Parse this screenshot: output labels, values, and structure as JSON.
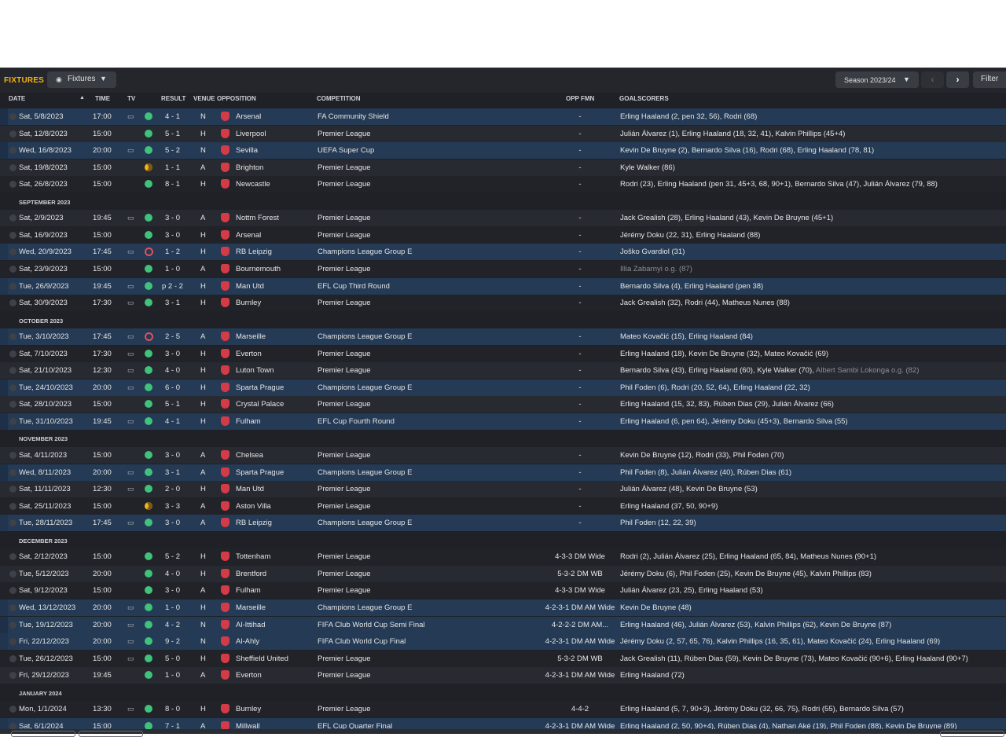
{
  "toolbar": {
    "title": "FIXTURES",
    "view_label": "Fixtures",
    "season_label": "Season 2023/24",
    "filter_label": "Filter",
    "prev_icon": "chevron-left-icon",
    "next_icon": "chevron-right-icon"
  },
  "columns": {
    "date": "DATE",
    "time": "TIME",
    "tv": "TV",
    "result": "RESULT",
    "venue": "VENUE",
    "opposition": "OPPOSITION",
    "competition": "COMPETITION",
    "opp_fmn": "OPP FMN",
    "goalscorers": "GOALSCORERS"
  },
  "colors": {
    "accent": "#f5b016",
    "win": "#3fc37a",
    "draw": "#f3b221",
    "loss": "#e0505b",
    "background": "#1f2126"
  },
  "items": [
    {
      "kind": "match",
      "date": "Sat, 5/8/2023",
      "time": "17:00",
      "tv": true,
      "outcome": "w",
      "result": "4 - 1",
      "venue": "N",
      "opp": "Arsenal",
      "comp": "FA Community Shield",
      "fmn": "-",
      "scorers": "Erling Haaland (2, pen 32, 56), Rodri (68)",
      "cont": true
    },
    {
      "kind": "match",
      "date": "Sat, 12/8/2023",
      "time": "15:00",
      "tv": false,
      "outcome": "w",
      "result": "5 - 1",
      "venue": "H",
      "opp": "Liverpool",
      "comp": "Premier League",
      "fmn": "-",
      "scorers": "Julián Álvarez (1), Erling Haaland (18, 32, 41), Kalvin Phillips (45+4)"
    },
    {
      "kind": "match",
      "date": "Wed, 16/8/2023",
      "time": "20:00",
      "tv": true,
      "outcome": "w",
      "result": "5 - 2",
      "venue": "N",
      "opp": "Sevilla",
      "comp": "UEFA Super Cup",
      "fmn": "-",
      "scorers": "Kevin De Bruyne (2), Bernardo Silva (16), Rodri (68), Erling Haaland (78, 81)",
      "cont": true
    },
    {
      "kind": "match",
      "date": "Sat, 19/8/2023",
      "time": "15:00",
      "tv": false,
      "outcome": "d",
      "result": "1 - 1",
      "venue": "A",
      "opp": "Brighton",
      "comp": "Premier League",
      "fmn": "-",
      "scorers": "Kyle Walker (86)"
    },
    {
      "kind": "match",
      "date": "Sat, 26/8/2023",
      "time": "15:00",
      "tv": false,
      "outcome": "w",
      "result": "8 - 1",
      "venue": "H",
      "opp": "Newcastle",
      "comp": "Premier League",
      "fmn": "-",
      "scorers": "Rodri (23), Erling Haaland (pen 31, 45+3, 68, 90+1), Bernardo Silva (47), Julián Álvarez (79, 88)"
    },
    {
      "kind": "section",
      "label": "SEPTEMBER 2023"
    },
    {
      "kind": "match",
      "date": "Sat, 2/9/2023",
      "time": "19:45",
      "tv": true,
      "outcome": "w",
      "result": "3 - 0",
      "venue": "A",
      "opp": "Nottm Forest",
      "comp": "Premier League",
      "fmn": "-",
      "scorers": "Jack Grealish (28), Erling Haaland (43), Kevin De Bruyne (45+1)"
    },
    {
      "kind": "match",
      "date": "Sat, 16/9/2023",
      "time": "15:00",
      "tv": false,
      "outcome": "w",
      "result": "3 - 0",
      "venue": "H",
      "opp": "Arsenal",
      "comp": "Premier League",
      "fmn": "-",
      "scorers": "Jérémy Doku (22, 31), Erling Haaland (88)"
    },
    {
      "kind": "match",
      "date": "Wed, 20/9/2023",
      "time": "17:45",
      "tv": true,
      "outcome": "l",
      "result": "1 - 2",
      "venue": "H",
      "opp": "RB Leipzig",
      "comp": "Champions League Group E",
      "fmn": "-",
      "scorers": "Joško Gvardiol (31)",
      "cont": true
    },
    {
      "kind": "match",
      "date": "Sat, 23/9/2023",
      "time": "15:00",
      "tv": false,
      "outcome": "w",
      "result": "1 - 0",
      "venue": "A",
      "opp": "Bournemouth",
      "comp": "Premier League",
      "fmn": "-",
      "scorers": "",
      "og": "Illia Zabarnyi o.g. (87)"
    },
    {
      "kind": "match",
      "date": "Tue, 26/9/2023",
      "time": "19:45",
      "tv": true,
      "outcome": "w",
      "result": "p 2 - 2",
      "venue": "H",
      "opp": "Man Utd",
      "comp": "EFL Cup Third Round",
      "fmn": "-",
      "scorers": "Bernardo Silva (4), Erling Haaland (pen 38)",
      "cont": true
    },
    {
      "kind": "match",
      "date": "Sat, 30/9/2023",
      "time": "17:30",
      "tv": true,
      "outcome": "w",
      "result": "3 - 1",
      "venue": "H",
      "opp": "Burnley",
      "comp": "Premier League",
      "fmn": "-",
      "scorers": "Jack Grealish (32), Rodri (44), Matheus Nunes (88)"
    },
    {
      "kind": "section",
      "label": "OCTOBER 2023"
    },
    {
      "kind": "match",
      "date": "Tue, 3/10/2023",
      "time": "17:45",
      "tv": true,
      "outcome": "l",
      "result": "2 - 5",
      "venue": "A",
      "opp": "Marseille",
      "comp": "Champions League Group E",
      "fmn": "-",
      "scorers": "Mateo Kovačić (15), Erling Haaland (84)",
      "cont": true
    },
    {
      "kind": "match",
      "date": "Sat, 7/10/2023",
      "time": "17:30",
      "tv": true,
      "outcome": "w",
      "result": "3 - 0",
      "venue": "H",
      "opp": "Everton",
      "comp": "Premier League",
      "fmn": "-",
      "scorers": "Erling Haaland (18), Kevin De Bruyne (32), Mateo Kovačić (69)"
    },
    {
      "kind": "match",
      "date": "Sat, 21/10/2023",
      "time": "12:30",
      "tv": true,
      "outcome": "w",
      "result": "4 - 0",
      "venue": "H",
      "opp": "Luton Town",
      "comp": "Premier League",
      "fmn": "-",
      "scorers": "Bernardo Silva (43), Erling Haaland (60), Kyle Walker (70), ",
      "og": "Albert Sambi Lokonga o.g. (82)"
    },
    {
      "kind": "match",
      "date": "Tue, 24/10/2023",
      "time": "20:00",
      "tv": true,
      "outcome": "w",
      "result": "6 - 0",
      "venue": "H",
      "opp": "Sparta Prague",
      "comp": "Champions League Group E",
      "fmn": "-",
      "scorers": "Phil Foden (6), Rodri (20, 52, 64), Erling Haaland (22, 32)",
      "cont": true
    },
    {
      "kind": "match",
      "date": "Sat, 28/10/2023",
      "time": "15:00",
      "tv": false,
      "outcome": "w",
      "result": "5 - 1",
      "venue": "H",
      "opp": "Crystal Palace",
      "comp": "Premier League",
      "fmn": "-",
      "scorers": "Erling Haaland (15, 32, 83), Rúben Dias (29), Julián Álvarez (66)"
    },
    {
      "kind": "match",
      "date": "Tue, 31/10/2023",
      "time": "19:45",
      "tv": true,
      "outcome": "w",
      "result": "4 - 1",
      "venue": "H",
      "opp": "Fulham",
      "comp": "EFL Cup Fourth Round",
      "fmn": "-",
      "scorers": "Erling Haaland (6, pen 64), Jérémy Doku (45+3), Bernardo Silva (55)",
      "cont": true
    },
    {
      "kind": "section",
      "label": "NOVEMBER 2023"
    },
    {
      "kind": "match",
      "date": "Sat, 4/11/2023",
      "time": "15:00",
      "tv": false,
      "outcome": "w",
      "result": "3 - 0",
      "venue": "A",
      "opp": "Chelsea",
      "comp": "Premier League",
      "fmn": "-",
      "scorers": "Kevin De Bruyne (12), Rodri (33), Phil Foden (70)"
    },
    {
      "kind": "match",
      "date": "Wed, 8/11/2023",
      "time": "20:00",
      "tv": true,
      "outcome": "w",
      "result": "3 - 1",
      "venue": "A",
      "opp": "Sparta Prague",
      "comp": "Champions League Group E",
      "fmn": "-",
      "scorers": "Phil Foden (8), Julián Álvarez (40), Rúben Dias (61)",
      "cont": true
    },
    {
      "kind": "match",
      "date": "Sat, 11/11/2023",
      "time": "12:30",
      "tv": true,
      "outcome": "w",
      "result": "2 - 0",
      "venue": "H",
      "opp": "Man Utd",
      "comp": "Premier League",
      "fmn": "-",
      "scorers": "Julián Álvarez (48), Kevin De Bruyne (53)"
    },
    {
      "kind": "match",
      "date": "Sat, 25/11/2023",
      "time": "15:00",
      "tv": false,
      "outcome": "d",
      "result": "3 - 3",
      "venue": "A",
      "opp": "Aston Villa",
      "comp": "Premier League",
      "fmn": "-",
      "scorers": "Erling Haaland (37, 50, 90+9)"
    },
    {
      "kind": "match",
      "date": "Tue, 28/11/2023",
      "time": "17:45",
      "tv": true,
      "outcome": "w",
      "result": "3 - 0",
      "venue": "A",
      "opp": "RB Leipzig",
      "comp": "Champions League Group E",
      "fmn": "-",
      "scorers": "Phil Foden (12, 22, 39)",
      "cont": true
    },
    {
      "kind": "section",
      "label": "DECEMBER 2023"
    },
    {
      "kind": "match",
      "date": "Sat, 2/12/2023",
      "time": "15:00",
      "tv": false,
      "outcome": "w",
      "result": "5 - 2",
      "venue": "H",
      "opp": "Tottenham",
      "comp": "Premier League",
      "fmn": "4-3-3 DM Wide",
      "scorers": "Rodri (2), Julián Álvarez (25), Erling Haaland (65, 84), Matheus Nunes (90+1)"
    },
    {
      "kind": "match",
      "date": "Tue, 5/12/2023",
      "time": "20:00",
      "tv": false,
      "outcome": "w",
      "result": "4 - 0",
      "venue": "H",
      "opp": "Brentford",
      "comp": "Premier League",
      "fmn": "5-3-2 DM WB",
      "scorers": "Jérémy Doku (6), Phil Foden (25), Kevin De Bruyne (45), Kalvin Phillips (83)"
    },
    {
      "kind": "match",
      "date": "Sat, 9/12/2023",
      "time": "15:00",
      "tv": false,
      "outcome": "w",
      "result": "3 - 0",
      "venue": "A",
      "opp": "Fulham",
      "comp": "Premier League",
      "fmn": "4-3-3 DM Wide",
      "scorers": "Julián Álvarez (23, 25), Erling Haaland (53)"
    },
    {
      "kind": "match",
      "date": "Wed, 13/12/2023",
      "time": "20:00",
      "tv": true,
      "outcome": "w",
      "result": "1 - 0",
      "venue": "H",
      "opp": "Marseille",
      "comp": "Champions League Group E",
      "fmn": "4-2-3-1 DM AM Wide",
      "scorers": "Kevin De Bruyne (48)",
      "cont": true
    },
    {
      "kind": "match",
      "date": "Tue, 19/12/2023",
      "time": "20:00",
      "tv": true,
      "outcome": "w",
      "result": "4 - 2",
      "venue": "N",
      "opp": "Al-Ittihad",
      "comp": "FIFA Club World Cup Semi Final",
      "fmn": "4-2-2-2 DM AM...",
      "scorers": "Erling Haaland (46), Julián Álvarez (53), Kalvin Phillips (62), Kevin De Bruyne (87)",
      "cont": true
    },
    {
      "kind": "match",
      "date": "Fri, 22/12/2023",
      "time": "20:00",
      "tv": true,
      "outcome": "w",
      "result": "9 - 2",
      "venue": "N",
      "opp": "Al-Ahly",
      "comp": "FIFA Club World Cup Final",
      "fmn": "4-2-3-1 DM AM Wide",
      "scorers": "Jérémy Doku (2, 57, 65, 76), Kalvin Phillips (16, 35, 61), Mateo Kovačić (24), Erling Haaland (69)",
      "cont": true
    },
    {
      "kind": "match",
      "date": "Tue, 26/12/2023",
      "time": "15:00",
      "tv": true,
      "outcome": "w",
      "result": "5 - 0",
      "venue": "H",
      "opp": "Sheffield United",
      "comp": "Premier League",
      "fmn": "5-3-2 DM WB",
      "scorers": "Jack Grealish (11), Rúben Dias (59), Kevin De Bruyne (73), Mateo Kovačić (90+6), Erling Haaland (90+7)"
    },
    {
      "kind": "match",
      "date": "Fri, 29/12/2023",
      "time": "19:45",
      "tv": false,
      "outcome": "w",
      "result": "1 - 0",
      "venue": "A",
      "opp": "Everton",
      "comp": "Premier League",
      "fmn": "4-2-3-1 DM AM Wide",
      "scorers": "Erling Haaland (72)"
    },
    {
      "kind": "section",
      "label": "JANUARY 2024"
    },
    {
      "kind": "match",
      "date": "Mon, 1/1/2024",
      "time": "13:30",
      "tv": true,
      "outcome": "w",
      "result": "8 - 0",
      "venue": "H",
      "opp": "Burnley",
      "comp": "Premier League",
      "fmn": "4-4-2",
      "scorers": "Erling Haaland (5, 7, 90+3), Jérémy Doku (32, 66, 75), Rodri (55), Bernardo Silva (57)"
    },
    {
      "kind": "match",
      "date": "Sat, 6/1/2024",
      "time": "15:00",
      "tv": false,
      "outcome": "w",
      "result": "7 - 1",
      "venue": "A",
      "opp": "Millwall",
      "comp": "EFL Cup Quarter Final",
      "fmn": "4-2-3-1 DM AM Wide",
      "scorers": "Erling Haaland (2, 50, 90+4), Rúben Dias (4), Nathan Aké (19), Phil Foden (88), Kevin De Bruyne (89)",
      "cont": true
    }
  ]
}
